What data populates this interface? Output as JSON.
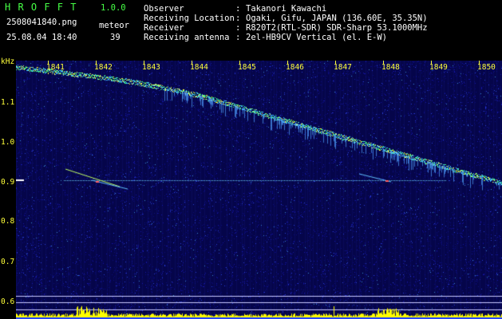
{
  "header": {
    "app_name": "H R O F F T",
    "version": "1.0.0",
    "filename": "2508041840.png",
    "category": "meteor",
    "timestamp": "25.08.04 18:40",
    "count": "39",
    "info": [
      {
        "label": "Observer",
        "sep": ":",
        "value": "Takanori Kawachi"
      },
      {
        "label": "Receiving Location",
        "sep": ":",
        "value": "Ogaki, Gifu, JAPAN (136.60E, 35.35N)"
      },
      {
        "label": "Receiver",
        "sep": ":",
        "value": "R820T2(RTL-SDR) SDR-Sharp 53.1000MHz"
      },
      {
        "label": "Receiving antenna",
        "sep": ":",
        "value": "2el-HB9CV Vertical (el. E-W)"
      }
    ]
  },
  "axes": {
    "y_unit": "kHz",
    "y_ticks": [
      "1.1",
      "1.0",
      "0.9",
      "0.8",
      "0.7",
      "0.6"
    ],
    "x_ticks": [
      "1841",
      "1842",
      "1843",
      "1844",
      "1845",
      "1846",
      "1847",
      "1848",
      "1849",
      "1850"
    ]
  },
  "colors": {
    "background": "#000000",
    "text_green": "#46ff46",
    "text_white": "#ffffff",
    "text_yellow": "#ffff3a",
    "noise_base": "#0a0a6e",
    "signal": "#ffff00"
  }
}
